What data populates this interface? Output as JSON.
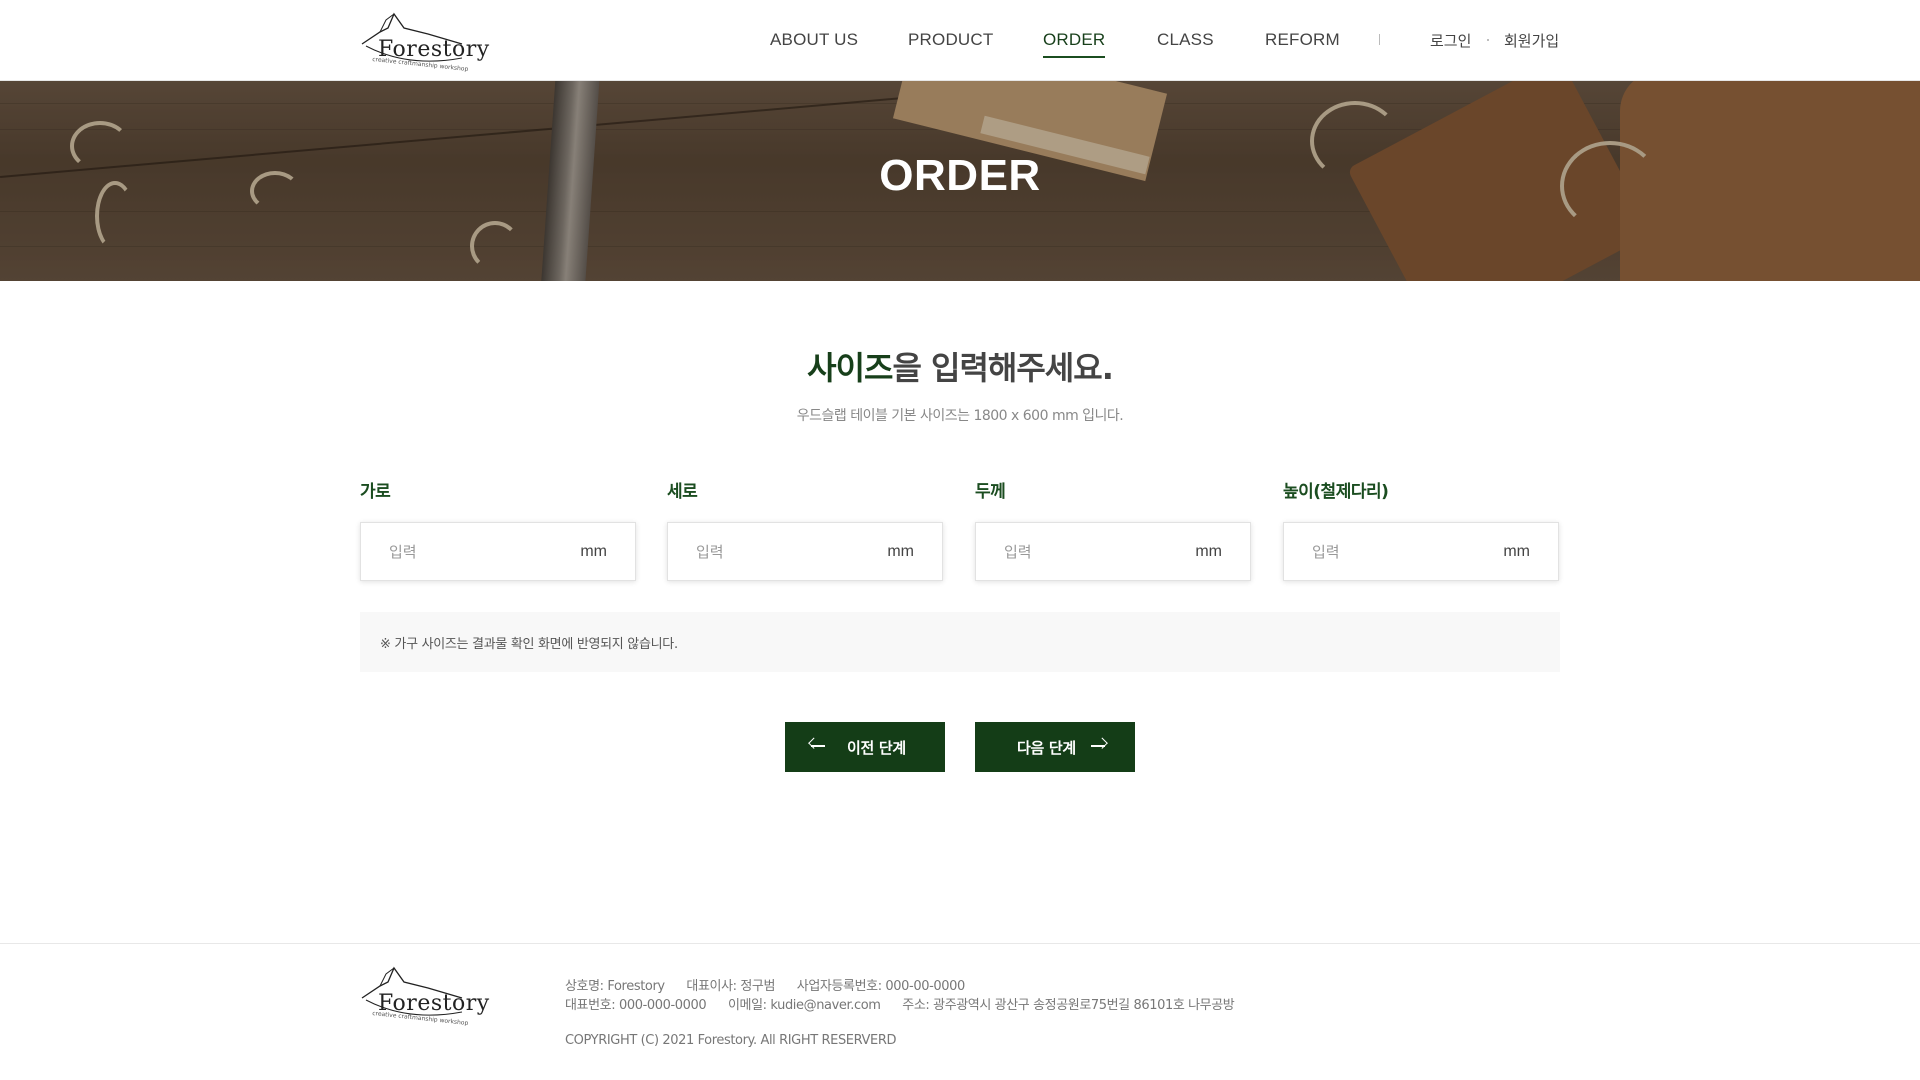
{
  "brand": {
    "logo_text": "Forestory",
    "logo_tagline": "creative craftmanship workshop"
  },
  "nav": {
    "items": [
      {
        "label": "ABOUT US",
        "active": false
      },
      {
        "label": "PRODUCT",
        "active": false
      },
      {
        "label": "ORDER",
        "active": true
      },
      {
        "label": "CLASS",
        "active": false
      },
      {
        "label": "REFORM",
        "active": false
      }
    ],
    "login": "로그인",
    "signup": "회원가입"
  },
  "hero": {
    "title": "ORDER"
  },
  "main": {
    "heading_accent": "사이즈",
    "heading_rest": "을 입력해주세요.",
    "subtext": "우드슬랩 테이블 기본 사이즈는 1800 x 600 mm 입니다.",
    "fields": [
      {
        "label": "가로",
        "placeholder": "입력",
        "unit": "mm"
      },
      {
        "label": "세로",
        "placeholder": "입력",
        "unit": "mm"
      },
      {
        "label": "두께",
        "placeholder": "입력",
        "unit": "mm"
      },
      {
        "label": "높이(철제다리)",
        "placeholder": "입력",
        "unit": "mm"
      }
    ],
    "notice": "※ 가구 사이즈는 결과물 확인 화면에 반영되지 않습니다.",
    "prev_label": "이전 단계",
    "next_label": "다음 단계"
  },
  "footer": {
    "company": "상호명: Forestory",
    "ceo": "대표이사: 정구범",
    "business_no": "사업자등록번호: 000-00-0000",
    "phone": "대표번호: 000-000-0000",
    "email": "이메일: kudie@naver.com",
    "address": "주소: 광주광역시 광산구 송정공원로75번길 86101호 나무공방",
    "copyright": "COPYRIGHT (C) 2021 Forestory. All RIGHT RESERVERD"
  },
  "colors": {
    "accent": "#173f1a",
    "button": "#143d17",
    "notice_bg": "#f8f8f8"
  }
}
